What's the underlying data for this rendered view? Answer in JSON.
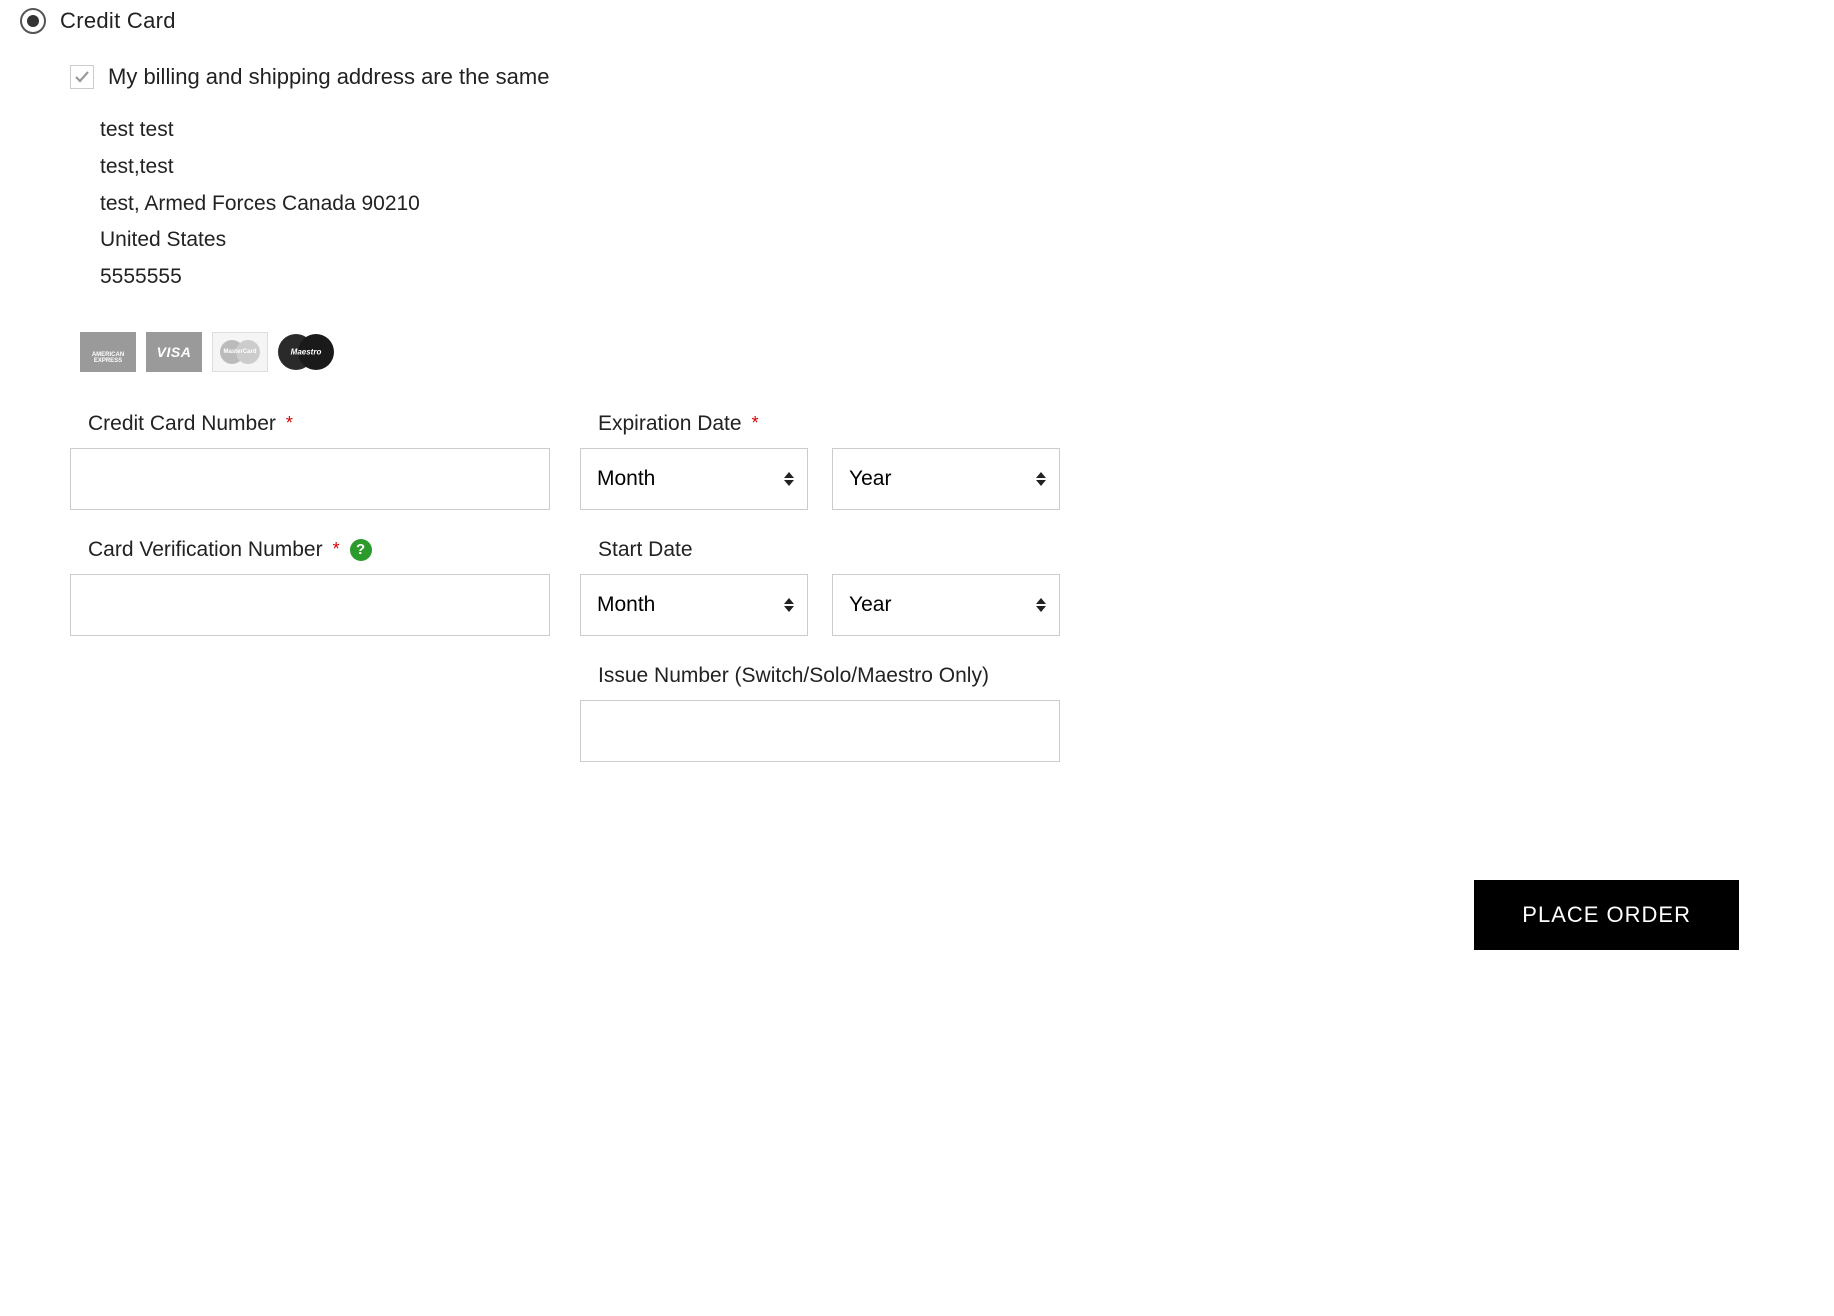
{
  "payment_method": {
    "label": "Credit Card",
    "selected": true
  },
  "billing_same": {
    "label": "My billing and shipping address are the same",
    "checked": true
  },
  "address": {
    "name": "test test",
    "line1": "test,test",
    "city_state_zip": "test, Armed Forces Canada 90210",
    "country": "United States",
    "phone": "5555555"
  },
  "card_brands": [
    "amex",
    "visa",
    "mastercard",
    "maestro"
  ],
  "form": {
    "cc_number_label": "Credit Card Number",
    "cvn_label": "Card Verification Number",
    "expiration_label": "Expiration Date",
    "start_date_label": "Start Date",
    "issue_number_label": "Issue Number (Switch/Solo/Maestro Only)",
    "month_placeholder": "Month",
    "year_placeholder": "Year"
  },
  "place_order_label": "PLACE ORDER",
  "required_mark": "*",
  "help_mark": "?"
}
